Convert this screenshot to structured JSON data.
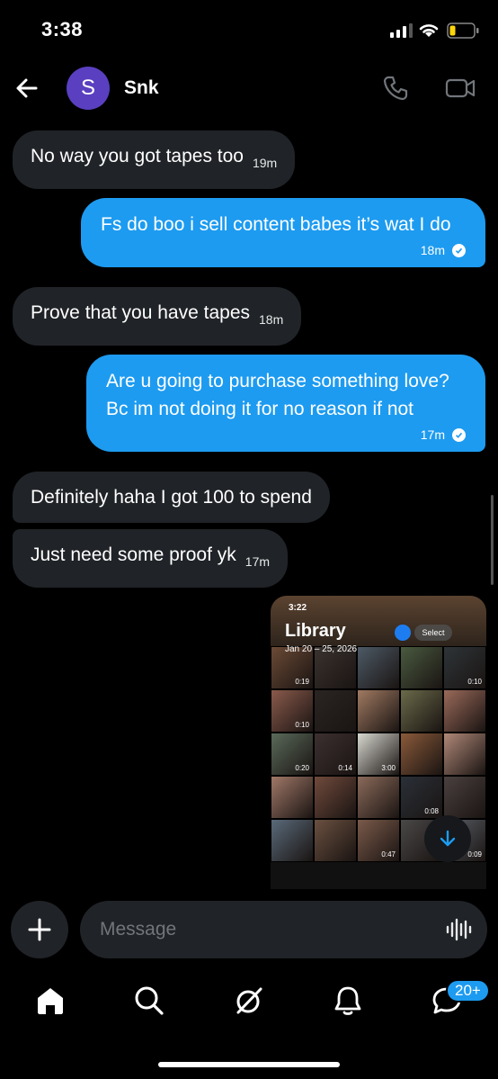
{
  "status_bar": {
    "time": "3:38"
  },
  "header": {
    "avatar_letter": "S",
    "contact_name": "Snk"
  },
  "messages": [
    {
      "text": "No way you got tapes too",
      "time": "19m"
    },
    {
      "text": "Fs do boo i sell content babes it’s wat I do",
      "time": "18m"
    },
    {
      "text": "Prove that you have tapes",
      "time": "18m"
    },
    {
      "line1": "Are u going to purchase something love?",
      "line2": "Bc im not doing it for no reason if not",
      "time": "17m"
    },
    {
      "text": "Definitely haha I got 100 to spend"
    },
    {
      "text": "Just need some proof yk",
      "time": "17m"
    }
  ],
  "media": {
    "time": "3:22",
    "title": "Library",
    "date_range": "Jan 20 – 25, 2026",
    "select_label": "Select",
    "durations": [
      "0:19",
      "",
      "",
      "",
      "0:10",
      "0:10",
      "",
      "",
      "",
      "",
      "0:20",
      "0:14",
      "3:00",
      "",
      "",
      "",
      "",
      "",
      "0:08",
      "",
      "",
      "",
      "0:47",
      "",
      "0:09"
    ]
  },
  "composer": {
    "placeholder": "Message"
  },
  "nav": {
    "messages_badge": "20+"
  },
  "colors": {
    "accent": "#1d9bf0",
    "bubble_incoming": "#202327",
    "background": "#000000"
  }
}
